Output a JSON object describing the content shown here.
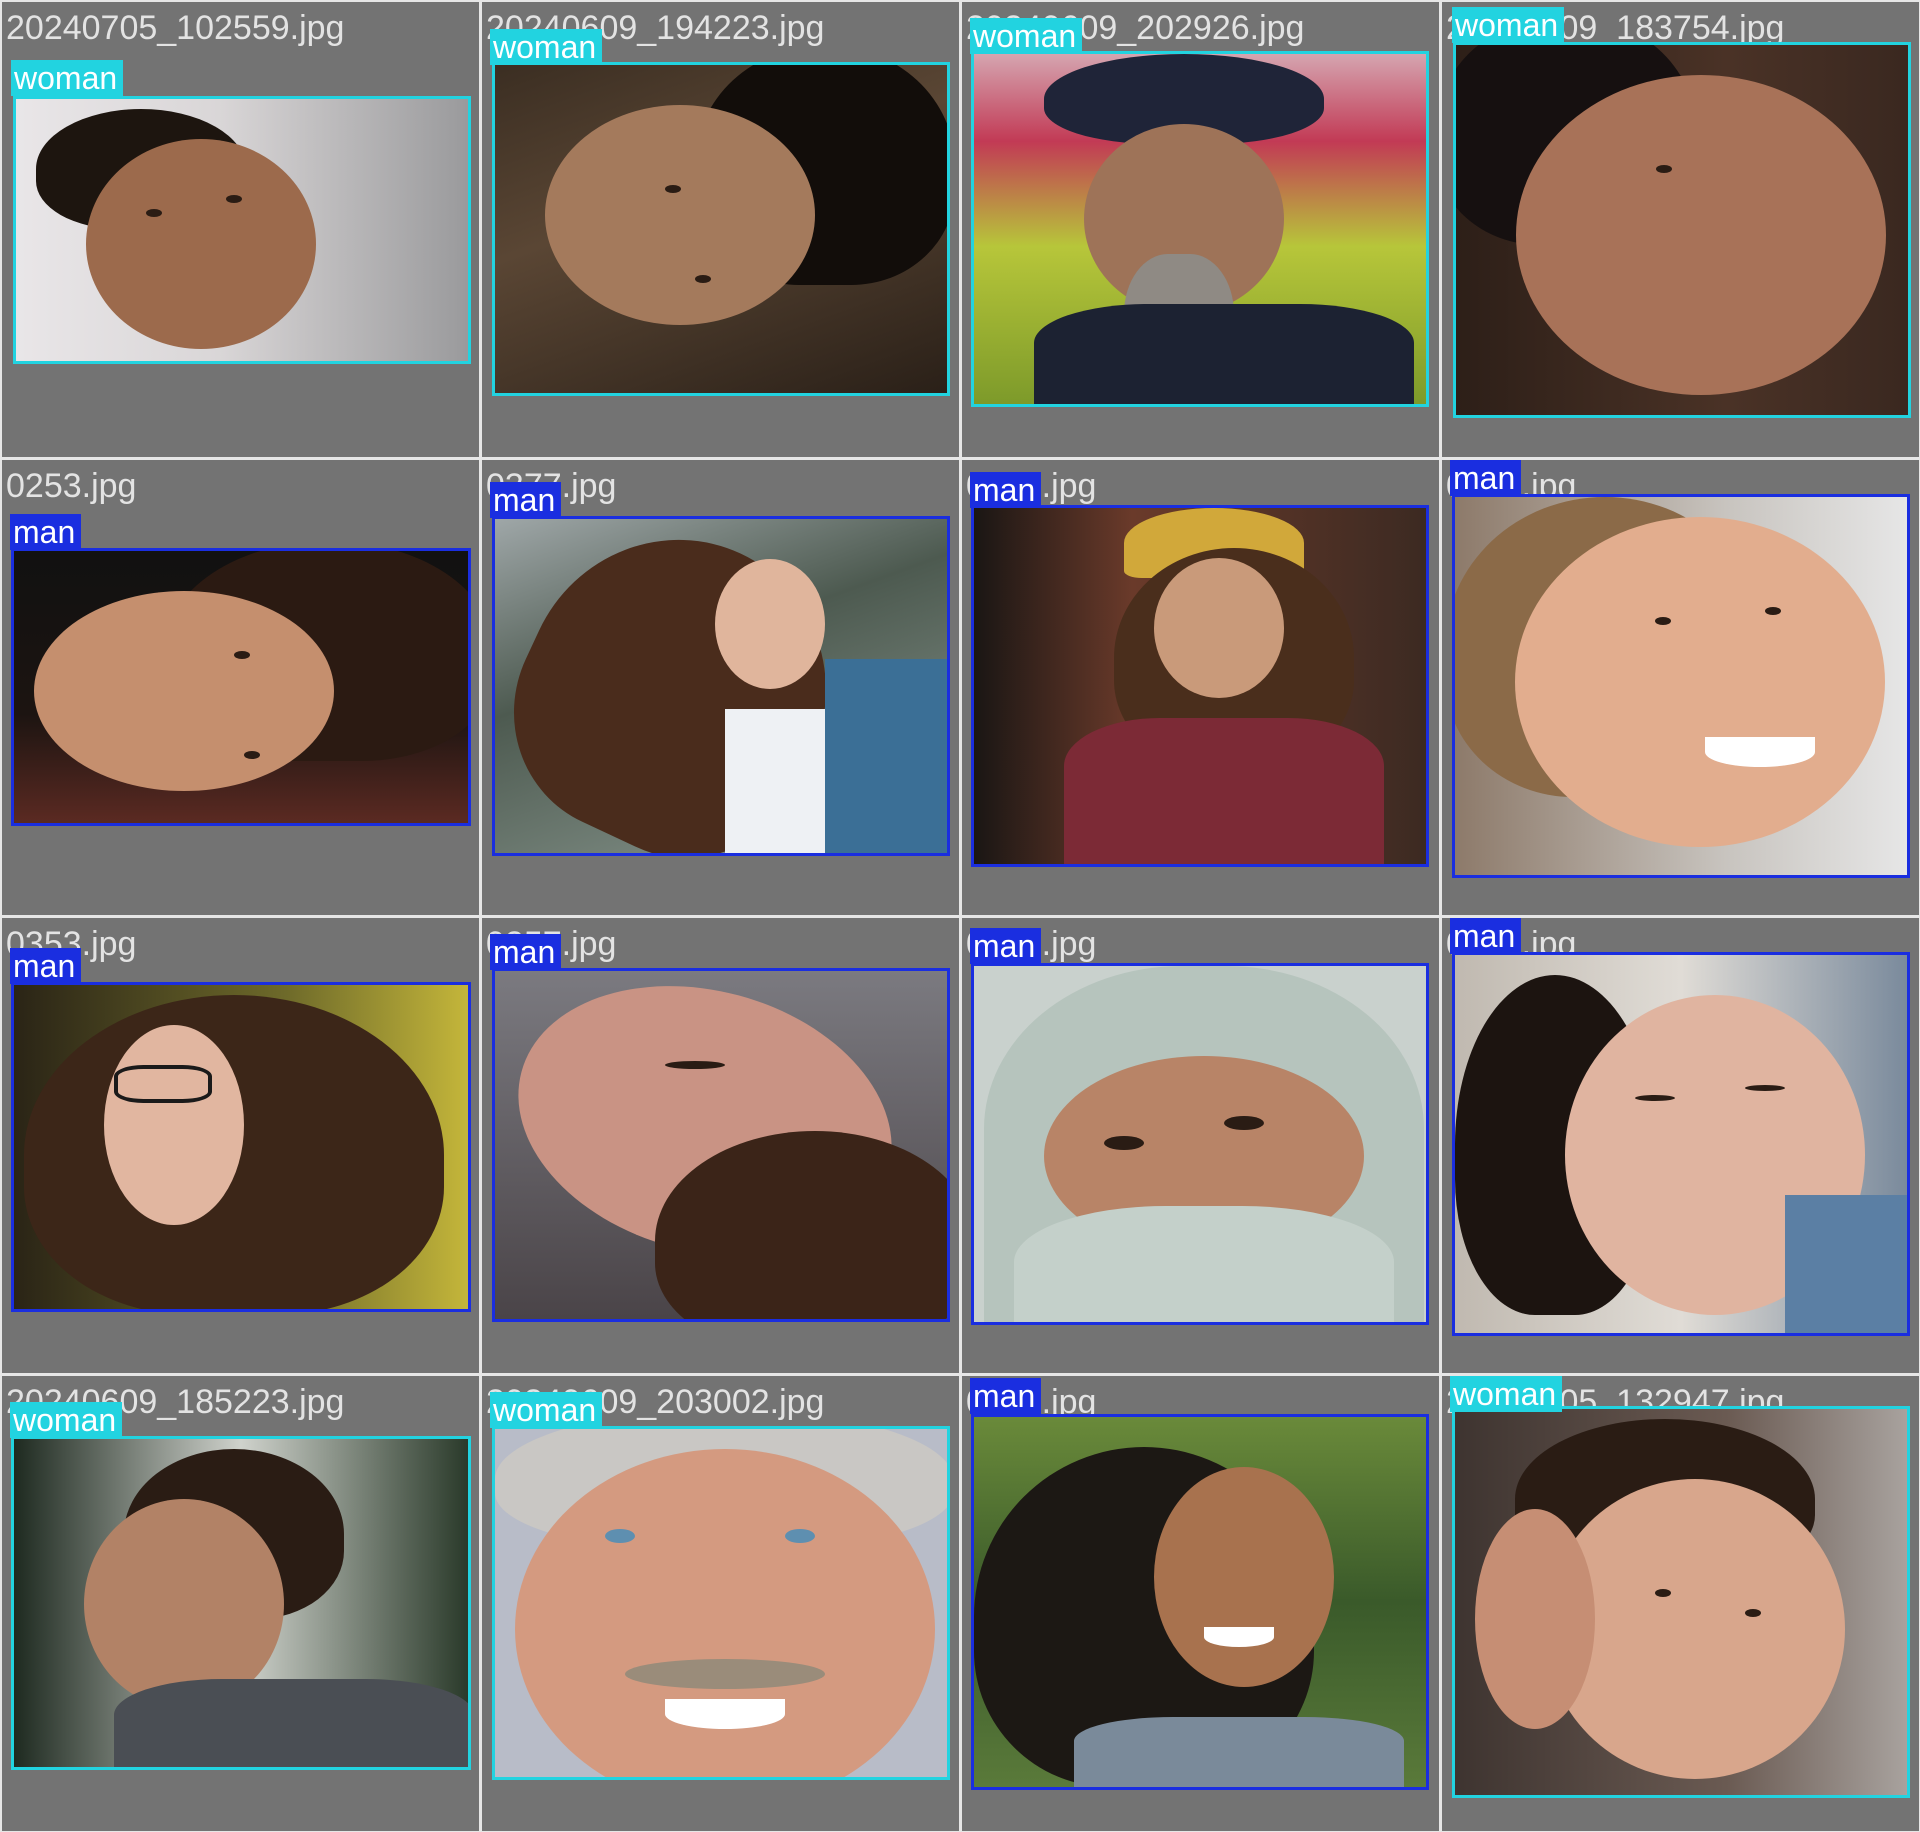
{
  "colors": {
    "woman": "#22d3e0",
    "man": "#1a2ee0",
    "tile_bg": "#737373",
    "grid_line": "#e6e6e6"
  },
  "tiles": [
    {
      "filename": "20240705_102559.jpg",
      "label": "woman"
    },
    {
      "filename": "20240609_194223.jpg",
      "label": "woman"
    },
    {
      "filename": "20240609_202926.jpg",
      "label": "woman"
    },
    {
      "filename": "20240609_183754.jpg",
      "label": "woman"
    },
    {
      "filename": "0253.jpg",
      "label": "man"
    },
    {
      "filename": "0377.jpg",
      "label": "man"
    },
    {
      "filename": "0136.jpg",
      "label": "man"
    },
    {
      "filename": "0129.jpg",
      "label": "man"
    },
    {
      "filename": "0353.jpg",
      "label": "man"
    },
    {
      "filename": "0257.jpg",
      "label": "man"
    },
    {
      "filename": "0181.jpg",
      "label": "man"
    },
    {
      "filename": "0164.jpg",
      "label": "man"
    },
    {
      "filename": "20240609_185223.jpg",
      "label": "woman"
    },
    {
      "filename": "20240609_203002.jpg",
      "label": "woman"
    },
    {
      "filename": "0142.jpg",
      "label": "man"
    },
    {
      "filename": "20240705_132947.jpg",
      "label": "woman"
    }
  ]
}
